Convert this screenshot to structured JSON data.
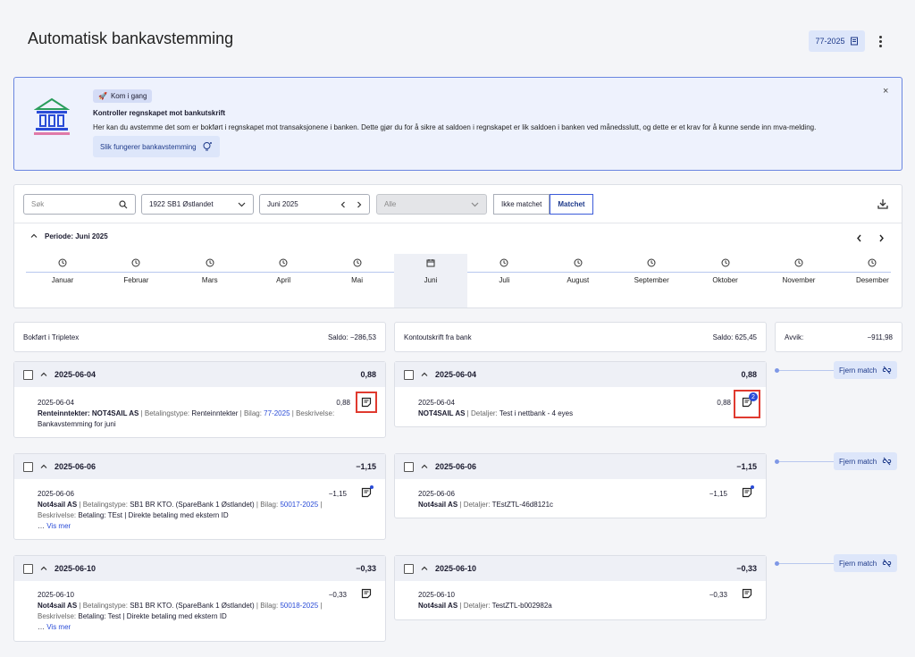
{
  "page": {
    "title": "Automatisk bankavstemming",
    "voucher_button": "77-2025"
  },
  "banner": {
    "badge": "Kom i gang",
    "heading": "Kontroller regnskapet mot bankutskrift",
    "text": "Her kan du avstemme det som er bokført i regnskapet mot transaksjonene i banken. Dette gjør du for å sikre at saldoen i regnskapet er lik saldoen i banken ved månedsslutt, og dette er et krav for å kunne sende inn mva-melding.",
    "link": "Slik fungerer bankavstemming",
    "close": "×"
  },
  "filters": {
    "search_placeholder": "Søk",
    "account": "1922 SB1 Østlandet",
    "period": "Juni 2025",
    "type": "Alle",
    "unmatched": "Ikke matchet",
    "matched": "Matchet"
  },
  "period_header": "Periode: Juni 2025",
  "months": [
    "Januar",
    "Februar",
    "Mars",
    "April",
    "Mai",
    "Juni",
    "Juli",
    "August",
    "September",
    "Oktober",
    "November",
    "Desember"
  ],
  "selected_month": "Juni",
  "ledger": {
    "label": "Bokført i Tripletex",
    "balance": "Saldo: −286,53"
  },
  "bank": {
    "label": "Kontoutskrift fra bank",
    "balance": "Saldo: 625,45"
  },
  "deviation": {
    "label": "Avvik:",
    "value": "−911,98"
  },
  "unmatch_label": "Fjern match",
  "groups": [
    {
      "date": "2025-06-04",
      "total": "0,88",
      "ledger_entry": {
        "date": "2025-06-04",
        "amount": "0,88",
        "name": "Renteinntekter: NOT4SAIL AS",
        "sep1": " | ",
        "type_label": "Betalingstype: ",
        "type": "Renteinntekter",
        "sep2": " | ",
        "voucher_label": "Bilag: ",
        "voucher": "77-2025",
        "sep3": " | ",
        "desc_label": "Beskrivelse:",
        "desc": "Bankavstemming for juni"
      },
      "bank_entry": {
        "date": "2025-06-04",
        "amount": "0,88",
        "name": "NOT4SAIL AS",
        "sep": " | ",
        "details_label": "Detaljer: ",
        "details": "Test i nettbank - 4 eyes",
        "attachments": "2"
      }
    },
    {
      "date": "2025-06-06",
      "total": "−1,15",
      "ledger_entry": {
        "date": "2025-06-06",
        "amount": "−1,15",
        "name": "Not4sail AS",
        "sep1": " | ",
        "type_label": "Betalingstype: ",
        "type": "SB1 BR KTO. (SpareBank 1 Østlandet)",
        "sep2": " | ",
        "voucher_label": "Bilag: ",
        "voucher": "50017-2025",
        "sep3": " |",
        "desc_label": "Beskrivelse: ",
        "desc": "Betaling: TEst | Direkte betaling med ekstern ID",
        "more": "Vis mer"
      },
      "bank_entry": {
        "date": "2025-06-06",
        "amount": "−1,15",
        "name": "Not4sail AS",
        "sep": " | ",
        "details_label": "Detaljer: ",
        "details": "TEstZTL-46d8121c"
      }
    },
    {
      "date": "2025-06-10",
      "total": "−0,33",
      "ledger_entry": {
        "date": "2025-06-10",
        "amount": "−0,33",
        "name": "Not4sail AS",
        "sep1": " | ",
        "type_label": "Betalingstype: ",
        "type": "SB1 BR KTO. (SpareBank 1 Østlandet)",
        "sep2": " | ",
        "voucher_label": "Bilag: ",
        "voucher": "50018-2025",
        "sep3": " |",
        "desc_label": "Beskrivelse: ",
        "desc": "Betaling: Test | Direkte betaling med ekstern ID",
        "more": "Vis mer"
      },
      "bank_entry": {
        "date": "2025-06-10",
        "amount": "−0,33",
        "name": "Not4sail AS",
        "sep": " | ",
        "details_label": "Detaljer: ",
        "details": "TestZTL-b002982a"
      }
    }
  ],
  "colors": {
    "accent": "#2a4cd7",
    "highlight": "#e03a2f",
    "banner_bg": "#eef2fd"
  }
}
